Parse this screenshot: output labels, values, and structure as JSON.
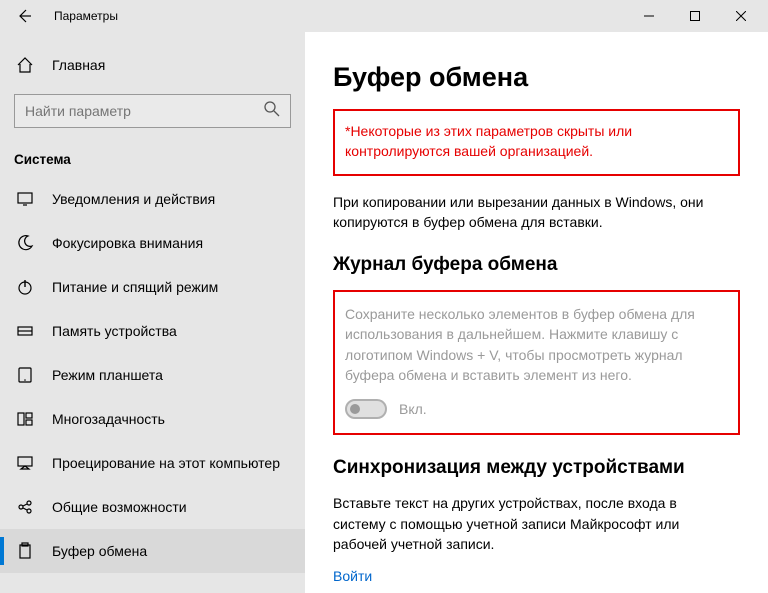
{
  "titlebar": {
    "title": "Параметры"
  },
  "sidebar": {
    "home": "Главная",
    "search_placeholder": "Найти параметр",
    "group": "Система",
    "items": [
      {
        "label": "Уведомления и действия"
      },
      {
        "label": "Фокусировка внимания"
      },
      {
        "label": "Питание и спящий режим"
      },
      {
        "label": "Память устройства"
      },
      {
        "label": "Режим планшета"
      },
      {
        "label": "Многозадачность"
      },
      {
        "label": "Проецирование на этот компьютер"
      },
      {
        "label": "Общие возможности"
      },
      {
        "label": "Буфер обмена",
        "active": true
      }
    ]
  },
  "main": {
    "title": "Буфер обмена",
    "warning": "*Некоторые из этих параметров скрыты или контролируются вашей организацией.",
    "intro": "При копировании или вырезании данных в Windows, они копируются в буфер обмена для вставки.",
    "history": {
      "heading": "Журнал буфера обмена",
      "desc": "Сохраните несколько элементов в буфер обмена для использования в дальнейшем. Нажмите клавишу с логотипом Windows + V, чтобы просмотреть журнал буфера обмена и вставить элемент из него.",
      "toggle_label": "Вкл."
    },
    "sync": {
      "heading": "Синхронизация между устройствами",
      "desc": "Вставьте текст на других устройствах, после входа в систему с помощью учетной записи Майкрософт или рабочей учетной записи.",
      "link": "Войти"
    }
  }
}
